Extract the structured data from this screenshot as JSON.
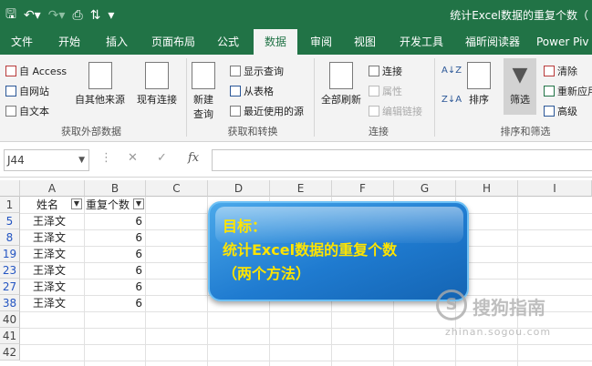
{
  "window": {
    "title": "统计Excel数据的重复个数（"
  },
  "tabs": [
    {
      "label": "文件"
    },
    {
      "label": "开始"
    },
    {
      "label": "插入"
    },
    {
      "label": "页面布局"
    },
    {
      "label": "公式"
    },
    {
      "label": "数据"
    },
    {
      "label": "审阅"
    },
    {
      "label": "视图"
    },
    {
      "label": "开发工具"
    },
    {
      "label": "福昕阅读器"
    },
    {
      "label": "Power Piv"
    }
  ],
  "ribbon": {
    "external": {
      "access": "自 Access",
      "web": "自网站",
      "text": "自文本",
      "other": "自其他来源",
      "existing": "现有连接",
      "group": "获取外部数据"
    },
    "transform": {
      "newquery": "新建",
      "newquery2": "查询",
      "show": "显示查询",
      "table": "从表格",
      "recent": "最近使用的源",
      "group": "获取和转换"
    },
    "connections": {
      "refresh": "全部刷新",
      "conn": "连接",
      "props": "属性",
      "editlinks": "编辑链接",
      "group": "连接"
    },
    "sortfilter": {
      "sort": "排序",
      "filter": "筛选",
      "clear": "清除",
      "reapply": "重新应用",
      "advanced": "高级",
      "group": "排序和筛选"
    }
  },
  "formula_bar": {
    "namebox": "J44",
    "fx": "fx",
    "value": ""
  },
  "columns": [
    "A",
    "B",
    "C",
    "D",
    "E",
    "F",
    "G",
    "H",
    "I"
  ],
  "rows": [
    {
      "num": "1",
      "a": "姓名",
      "b": "重复个数",
      "link": false
    },
    {
      "num": "5",
      "a": "王泽文",
      "b": "6",
      "link": true
    },
    {
      "num": "8",
      "a": "王泽文",
      "b": "6",
      "link": true
    },
    {
      "num": "19",
      "a": "王泽文",
      "b": "6",
      "link": true
    },
    {
      "num": "23",
      "a": "王泽文",
      "b": "6",
      "link": true
    },
    {
      "num": "27",
      "a": "王泽文",
      "b": "6",
      "link": true
    },
    {
      "num": "38",
      "a": "王泽文",
      "b": "6",
      "link": true
    },
    {
      "num": "40",
      "a": "",
      "b": "",
      "link": false
    },
    {
      "num": "41",
      "a": "",
      "b": "",
      "link": false
    },
    {
      "num": "42",
      "a": "",
      "b": "",
      "link": false
    }
  ],
  "callout": {
    "line1": "目标：",
    "line2": "统计Excel数据的重复个数",
    "line3": "（两个方法）"
  },
  "watermark": {
    "brand": "搜狗指南",
    "url": "zhinan.sogou.com"
  }
}
